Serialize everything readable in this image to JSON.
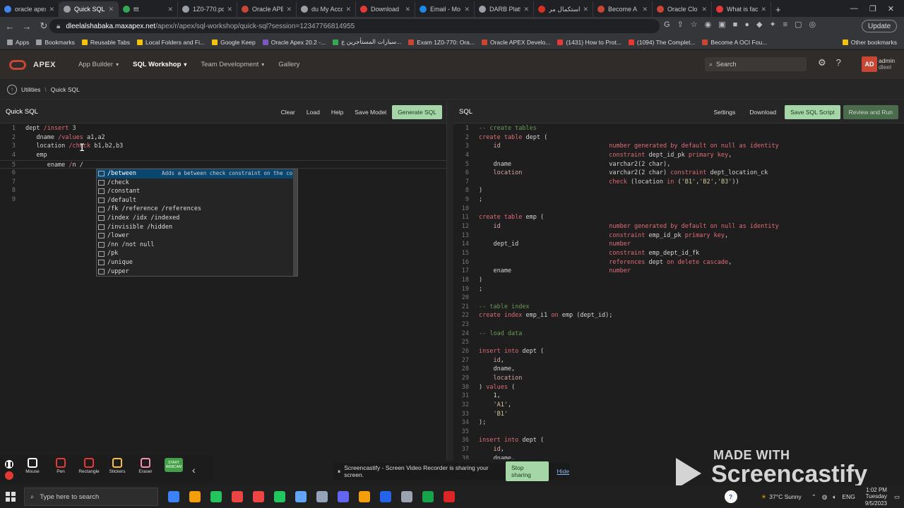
{
  "browser": {
    "tabs": [
      {
        "label": "oracle apex",
        "color": "#4285f4",
        "active": false
      },
      {
        "label": "Quick SQL",
        "color": "#9aa0a6",
        "active": true
      },
      {
        "label": "ttt",
        "color": "#34a853",
        "active": false
      },
      {
        "label": "1Z0-770.pdf",
        "color": "#9aa0a6",
        "active": false
      },
      {
        "label": "Oracle APEX",
        "color": "#c74634",
        "active": false
      },
      {
        "label": "du My Acco",
        "color": "#9aa0a6",
        "active": false
      },
      {
        "label": "Download",
        "color": "#e53935",
        "active": false
      },
      {
        "label": "Email - Mo",
        "color": "#1e88e5",
        "active": false
      },
      {
        "label": "DARB Platfo",
        "color": "#9aa0a6",
        "active": false
      },
      {
        "label": "استكمال مر",
        "color": "#d93025",
        "active": false
      },
      {
        "label": "Become A",
        "color": "#c74634",
        "active": false
      },
      {
        "label": "Oracle Clo",
        "color": "#c74634",
        "active": false
      },
      {
        "label": "What is fac",
        "color": "#e53935",
        "active": false
      }
    ],
    "new_tab": "+",
    "url_prefix": "dleelalshabaka.maxapex.net",
    "url_path": "/apex/r/apex/sql-workshop/quick-sql?session=12347766814955",
    "update_label": "Update",
    "bookmarks": [
      {
        "label": "Apps",
        "color": "#9aa0a6"
      },
      {
        "label": "Bookmarks",
        "color": "#9aa0a6"
      },
      {
        "label": "Reusable Tabs",
        "color": "#f4c20d"
      },
      {
        "label": "Local Folders and Fi...",
        "color": "#f4c20d"
      },
      {
        "label": "Google Keep",
        "color": "#f4c20d"
      },
      {
        "label": "Oracle Apex 20.2 -...",
        "color": "#7e57c2"
      },
      {
        "label": "سيارات المستأجرين ع...",
        "color": "#34a853"
      },
      {
        "label": "Exam 1Z0-770: Ora...",
        "color": "#c74634"
      },
      {
        "label": "Oracle APEX Develo...",
        "color": "#c74634"
      },
      {
        "label": "(1431) How to Prot...",
        "color": "#e53935"
      },
      {
        "label": "(1094) The Complet...",
        "color": "#e53935"
      },
      {
        "label": "Become A OCI Fou...",
        "color": "#c74634"
      }
    ],
    "other_bookmarks": "Other bookmarks"
  },
  "apex": {
    "logo_text": "APEX",
    "nav": [
      {
        "label": "App Builder",
        "caret": "▾",
        "active": false
      },
      {
        "label": "SQL Workshop",
        "caret": "▾",
        "active": true
      },
      {
        "label": "Team Development",
        "caret": "▾",
        "active": false
      },
      {
        "label": "Gallery",
        "caret": "",
        "active": false
      }
    ],
    "search_placeholder": "Search",
    "avatar_initials": "AD",
    "user_name": "admin",
    "user_workspace": "dleel",
    "breadcrumb": [
      "Utilities",
      "Quick SQL"
    ]
  },
  "quicksql": {
    "title": "Quick SQL",
    "buttons": [
      "Clear",
      "Load",
      "Help",
      "Save Model"
    ],
    "generate_label": "Generate SQL",
    "lines": [
      [
        [
          "c-plain",
          "dept "
        ],
        [
          "c-kw",
          "/insert "
        ],
        [
          "c-num",
          "3"
        ]
      ],
      [
        [
          "c-plain",
          "   dname "
        ],
        [
          "c-kw",
          "/values "
        ],
        [
          "c-plain",
          "a1,a2"
        ]
      ],
      [
        [
          "c-plain",
          "   location "
        ],
        [
          "c-kw",
          "/check "
        ],
        [
          "c-plain",
          "b1,b2,b3"
        ]
      ],
      [
        [
          "c-plain",
          "   emp"
        ]
      ],
      [
        [
          "c-plain",
          "      ename "
        ],
        [
          "c-kw",
          "/"
        ],
        [
          "c-plain",
          "n /"
        ]
      ],
      [],
      [],
      [],
      []
    ],
    "autocomplete": [
      {
        "label": "/between",
        "desc": "Adds a between check constraint on the co..."
      },
      {
        "label": "/check",
        "desc": ""
      },
      {
        "label": "/constant",
        "desc": ""
      },
      {
        "label": "/default",
        "desc": ""
      },
      {
        "label": "/fk /reference /references",
        "desc": ""
      },
      {
        "label": "/index /idx /indexed",
        "desc": ""
      },
      {
        "label": "/invisible /hidden",
        "desc": ""
      },
      {
        "label": "/lower",
        "desc": ""
      },
      {
        "label": "/nn /not null",
        "desc": ""
      },
      {
        "label": "/pk",
        "desc": ""
      },
      {
        "label": "/unique",
        "desc": ""
      },
      {
        "label": "/upper",
        "desc": ""
      }
    ]
  },
  "sql": {
    "title": "SQL",
    "buttons": [
      "Settings",
      "Download"
    ],
    "save_label": "Save SQL Script",
    "review_label": "Review and Run",
    "lines": [
      [
        [
          "c-cm",
          "-- create tables"
        ]
      ],
      [
        [
          "c-kw",
          "create table "
        ],
        [
          "c-plain",
          "dept ("
        ]
      ],
      [
        [
          "c-id",
          "    id                              "
        ],
        [
          "c-kw",
          "number generated by default on null as identity"
        ]
      ],
      [
        [
          "c-plain",
          "                                    "
        ],
        [
          "c-kw",
          "constraint "
        ],
        [
          "c-plain",
          "dept_id_pk "
        ],
        [
          "c-kw",
          "primary key"
        ],
        [
          "c-plain",
          ","
        ]
      ],
      [
        [
          "c-plain",
          "    dname                           varchar2(2 char),"
        ]
      ],
      [
        [
          "c-id",
          "    location                        "
        ],
        [
          "c-plain",
          "varchar2(2 char) "
        ],
        [
          "c-kw",
          "constraint "
        ],
        [
          "c-plain",
          "dept_location_ck"
        ]
      ],
      [
        [
          "c-plain",
          "                                    "
        ],
        [
          "c-kw",
          "check "
        ],
        [
          "c-plain",
          "(location "
        ],
        [
          "c-kw",
          "in "
        ],
        [
          "c-plain",
          "("
        ],
        [
          "c-str",
          "'B1'"
        ],
        [
          "c-plain",
          ","
        ],
        [
          "c-str",
          "'B2'"
        ],
        [
          "c-plain",
          ","
        ],
        [
          "c-str",
          "'B3'"
        ],
        [
          "c-plain",
          "))"
        ]
      ],
      [
        [
          "c-plain",
          ")"
        ]
      ],
      [
        [
          "c-plain",
          ";"
        ]
      ],
      [],
      [
        [
          "c-kw",
          "create table "
        ],
        [
          "c-plain",
          "emp ("
        ]
      ],
      [
        [
          "c-id",
          "    id                              "
        ],
        [
          "c-kw",
          "number generated by default on null as identity"
        ]
      ],
      [
        [
          "c-plain",
          "                                    "
        ],
        [
          "c-kw",
          "constraint "
        ],
        [
          "c-plain",
          "emp_id_pk "
        ],
        [
          "c-kw",
          "primary key"
        ],
        [
          "c-plain",
          ","
        ]
      ],
      [
        [
          "c-plain",
          "    dept_id                         "
        ],
        [
          "c-kw",
          "number"
        ]
      ],
      [
        [
          "c-plain",
          "                                    "
        ],
        [
          "c-kw",
          "constraint "
        ],
        [
          "c-plain",
          "emp_dept_id_fk"
        ]
      ],
      [
        [
          "c-plain",
          "                                    "
        ],
        [
          "c-kw",
          "references "
        ],
        [
          "c-plain",
          "dept "
        ],
        [
          "c-kw",
          "on delete cascade"
        ],
        [
          "c-plain",
          ","
        ]
      ],
      [
        [
          "c-plain",
          "    ename                           "
        ],
        [
          "c-kw",
          "number"
        ]
      ],
      [
        [
          "c-plain",
          ")"
        ]
      ],
      [
        [
          "c-plain",
          ";"
        ]
      ],
      [],
      [
        [
          "c-cm",
          "-- table index"
        ]
      ],
      [
        [
          "c-kw",
          "create index "
        ],
        [
          "c-plain",
          "emp_i1 "
        ],
        [
          "c-kw",
          "on "
        ],
        [
          "c-plain",
          "emp (dept_id);"
        ]
      ],
      [],
      [
        [
          "c-cm",
          "-- load data"
        ]
      ],
      [],
      [
        [
          "c-kw",
          "insert into "
        ],
        [
          "c-plain",
          "dept ("
        ]
      ],
      [
        [
          "c-id",
          "    id"
        ],
        [
          "c-plain",
          ","
        ]
      ],
      [
        [
          "c-plain",
          "    dname,"
        ]
      ],
      [
        [
          "c-id",
          "    location"
        ]
      ],
      [
        [
          "c-plain",
          ") "
        ],
        [
          "c-kw",
          "values "
        ],
        [
          "c-plain",
          "("
        ]
      ],
      [
        [
          "c-plain",
          "    1,"
        ]
      ],
      [
        [
          "c-str",
          "    'A1'"
        ],
        [
          "c-plain",
          ","
        ]
      ],
      [
        [
          "c-str",
          "    'B1'"
        ]
      ],
      [
        [
          "c-plain",
          ");"
        ]
      ],
      [],
      [
        [
          "c-kw",
          "insert into "
        ],
        [
          "c-plain",
          "dept ("
        ]
      ],
      [
        [
          "c-id",
          "    id"
        ],
        [
          "c-plain",
          ","
        ]
      ],
      [
        [
          "c-plain",
          "    dname,"
        ]
      ]
    ]
  },
  "screencastify": {
    "tools": [
      {
        "label": "Mouse",
        "color": "#ffffff"
      },
      {
        "label": "Pen",
        "color": "#e53935"
      },
      {
        "label": "Rectangle",
        "color": "#e53935"
      },
      {
        "label": "Stickers",
        "color": "#fbc02d"
      },
      {
        "label": "Eraser",
        "color": "#f48fb1"
      },
      {
        "label": "START WEBCAM",
        "color": "#43a047"
      }
    ],
    "share_text": "Screencastify - Screen Video Recorder is sharing your screen.",
    "stop_label": "Stop sharing",
    "hide_label": "Hide",
    "made_with": "MADE WITH",
    "brand": "Screencastify"
  },
  "taskbar": {
    "search_placeholder": "Type here to search",
    "apps": [
      "#3b82f6",
      "#f59e0b",
      "#22c55e",
      "#ef4444",
      "#ef4444",
      "#22c55e",
      "#60a5fa",
      "#94a3b8",
      "#6366f1",
      "#f59e0b",
      "#2563eb",
      "#9ca3af",
      "#16a34a",
      "#dc2626"
    ],
    "weather": "37°C  Sunny",
    "lang": "ENG",
    "time": "1:02 PM",
    "day": "Tuesday",
    "date": "9/5/2023"
  }
}
